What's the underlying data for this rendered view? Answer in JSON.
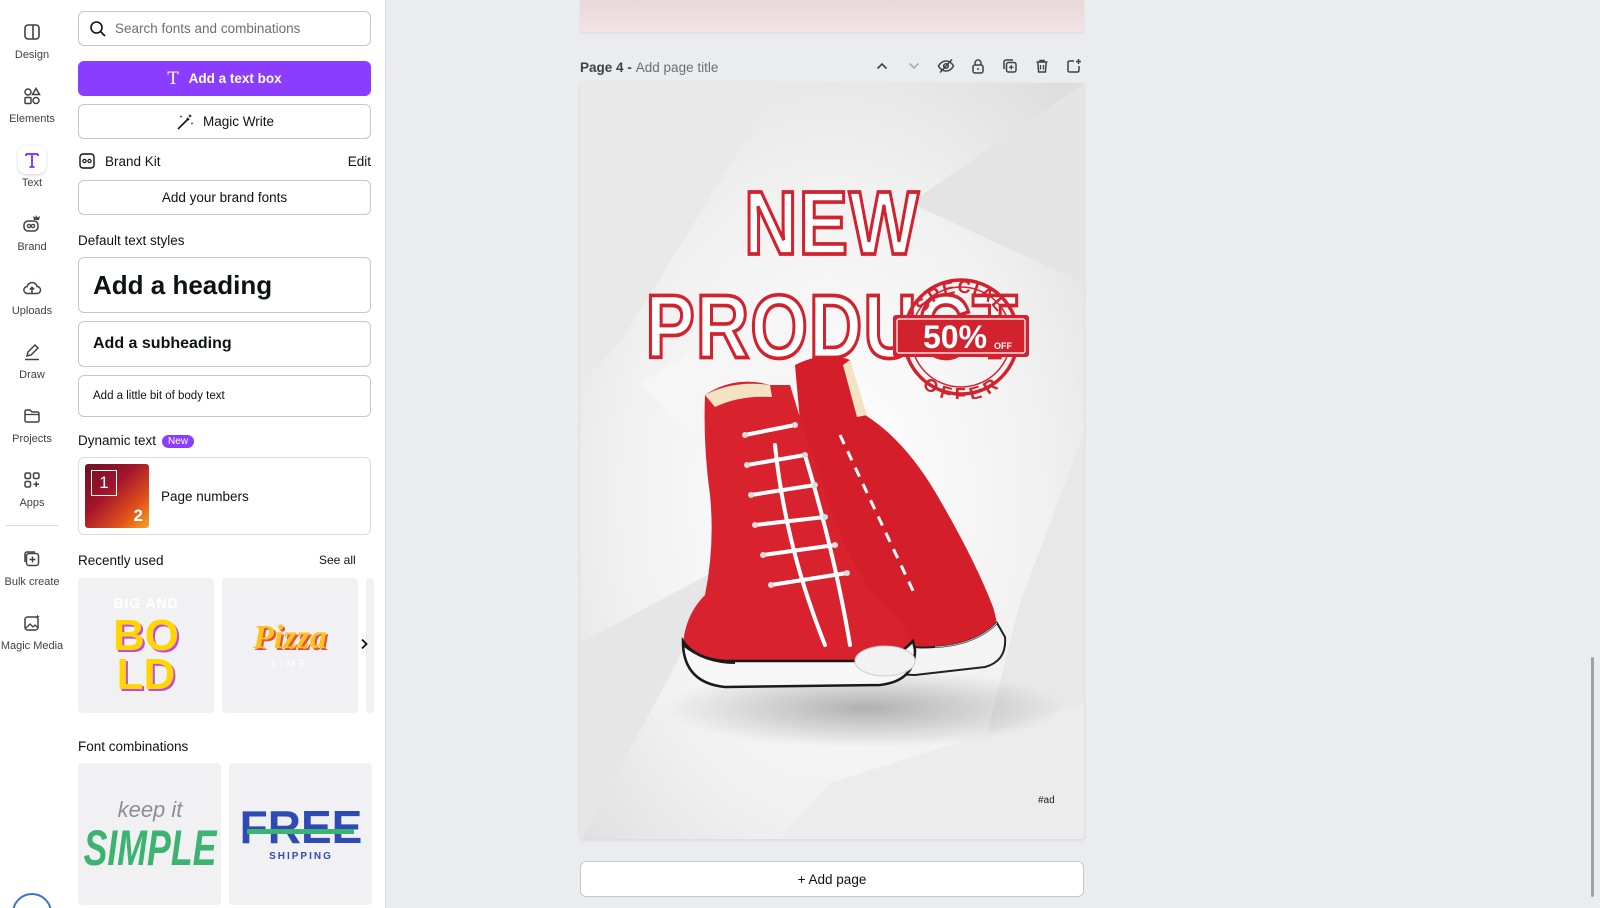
{
  "rail": {
    "items": [
      {
        "label": "Design",
        "icon": "design-icon"
      },
      {
        "label": "Elements",
        "icon": "elements-icon"
      },
      {
        "label": "Text",
        "icon": "text-icon"
      },
      {
        "label": "Brand",
        "icon": "brand-icon"
      },
      {
        "label": "Uploads",
        "icon": "uploads-icon"
      },
      {
        "label": "Draw",
        "icon": "draw-icon"
      },
      {
        "label": "Projects",
        "icon": "projects-icon"
      },
      {
        "label": "Apps",
        "icon": "apps-icon"
      },
      {
        "label": "Bulk create",
        "icon": "bulk-create-icon"
      },
      {
        "label": "Magic Media",
        "icon": "magic-media-icon"
      }
    ],
    "active": "Text"
  },
  "panel": {
    "search_placeholder": "Search fonts and combinations",
    "add_text_box": "Add a text box",
    "magic_write": "Magic Write",
    "brand_kit": "Brand Kit",
    "brand_kit_edit": "Edit",
    "add_brand_fonts": "Add your brand fonts",
    "default_styles_title": "Default text styles",
    "heading": "Add a heading",
    "subheading": "Add a subheading",
    "body": "Add a little bit of body text",
    "dynamic_text_title": "Dynamic text",
    "new_badge": "New",
    "page_numbers": "Page numbers",
    "page_numbers_thumb": {
      "first": "1",
      "second": "2"
    },
    "recently_used_title": "Recently used",
    "see_all": "See all",
    "recent_thumbs": [
      {
        "top": "BIG AND",
        "main_line1": "BO",
        "main_line2": "LD"
      },
      {
        "main": "Pizza",
        "sub": "TIME"
      }
    ],
    "font_combinations_title": "Font combinations",
    "combos": [
      {
        "line1": "keep it",
        "line2": "SIMPLE"
      },
      {
        "line1": "FREE",
        "line2": "SHIPPING"
      }
    ]
  },
  "canvas": {
    "page_number": "Page 4 -",
    "page_title_placeholder": "Add page title",
    "headline": "NEW PRODUCT",
    "badge": {
      "top": "SPECIAL",
      "middle": "50%",
      "off": "OFF",
      "bottom": "OFFER"
    },
    "ad_tag": "#ad",
    "add_page": "+ Add page"
  },
  "colors": {
    "accent": "#8b3dff",
    "headline_red": "#d1222e"
  }
}
